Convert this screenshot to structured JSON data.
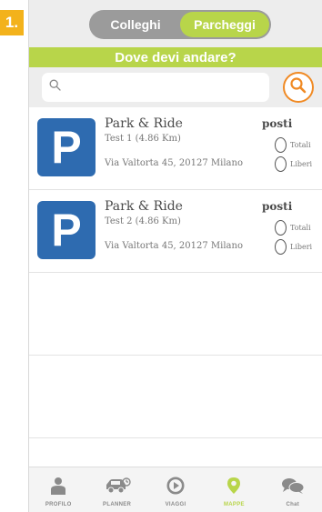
{
  "step_badge": "1.",
  "segmented": {
    "left_label": "Colleghi",
    "right_label": "Parcheggi",
    "active": "Parcheggi"
  },
  "banner": {
    "title": "Dove devi andare?"
  },
  "search": {
    "value": "",
    "placeholder": ""
  },
  "parkings": [
    {
      "icon": "P",
      "title": "Park & Ride",
      "subtitle": "Test 1 (4.86 Km)",
      "address": "Via Valtorta 45, 20127 Milano",
      "posti_label": "posti",
      "totali_label": "Totali",
      "liberi_label": "Liberi"
    },
    {
      "icon": "P",
      "title": "Park & Ride",
      "subtitle": "Test 2 (4.86 Km)",
      "address": "Via Valtorta 45, 20127 Milano",
      "posti_label": "posti",
      "totali_label": "Totali",
      "liberi_label": "Liberi"
    }
  ],
  "tabbar": {
    "items": [
      {
        "label": "PROFILO",
        "icon": "person-icon"
      },
      {
        "label": "PLANNER",
        "icon": "car-icon"
      },
      {
        "label": "VIAGGI",
        "icon": "play-icon"
      },
      {
        "label": "MAPPE",
        "icon": "map-pin-icon"
      },
      {
        "label": "Chat",
        "icon": "chat-icon"
      }
    ],
    "active": "MAPPE"
  },
  "colors": {
    "accent_green": "#b8d54a",
    "segment_gray": "#9b9b9b",
    "parking_blue": "#2e6bb0",
    "search_orange": "#f08a24",
    "badge_yellow": "#f3b21b"
  }
}
